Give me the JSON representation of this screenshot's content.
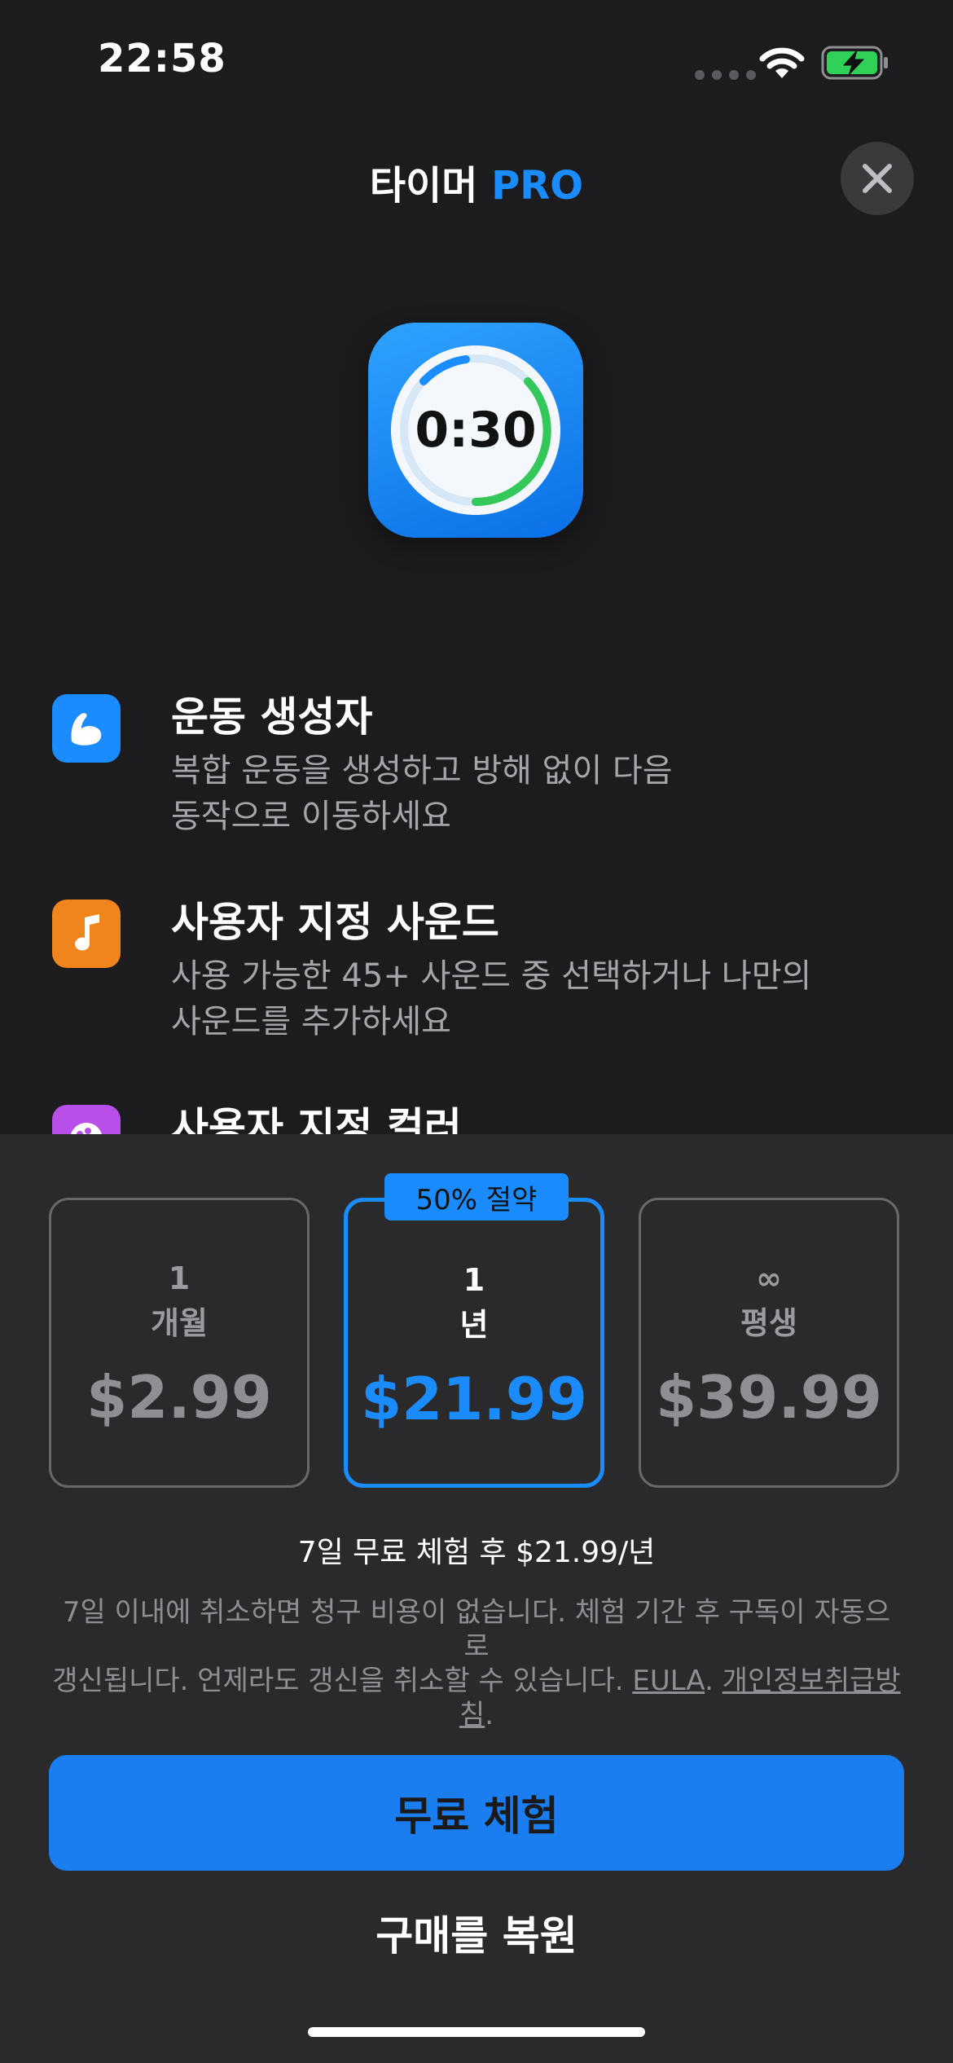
{
  "status_bar": {
    "time": "22:58"
  },
  "header": {
    "title_main": "타이머",
    "title_accent": "PRO"
  },
  "app_icon": {
    "display_time": "0:30"
  },
  "features": [
    {
      "title": "운동 생성자",
      "desc_line1": "복합 운동을 생성하고 방해 없이 다음",
      "desc_line2": "동작으로 이동하세요",
      "icon": "flexed-arm-icon",
      "color": "#1a8cff"
    },
    {
      "title": "사용자 지정 사운드",
      "desc_line1": "사용 가능한 45+ 사운드 중 선택하거나 나만의",
      "desc_line2": "사운드를 추가하세요",
      "icon": "music-note-icon",
      "color": "#f0851e"
    },
    {
      "title": "사용자 지정 컬러",
      "icon": "palette-icon",
      "color": "#b84fe8"
    }
  ],
  "plans": [
    {
      "count": "1",
      "unit": "개월",
      "price": "$2.99"
    },
    {
      "count": "1",
      "unit": "년",
      "price": "$21.99"
    },
    {
      "count": "∞",
      "unit": "평생",
      "price": "$39.99"
    }
  ],
  "badge": "50% 절약",
  "trial_summary": "7일 무료 체험 후 $21.99/년",
  "legal": {
    "line1": "7일 이내에 취소하면 청구 비용이 없습니다. 체험 기간 후 구독이 자동으로",
    "line2_text": "갱신됩니다. 언제라도 갱신을 취소할 수 있습니다. ",
    "eula": "EULA",
    "separator": ". ",
    "privacy_part1": "개인정보취급방",
    "privacy_part2": "침",
    "period": "."
  },
  "cta_label": "무료 체험",
  "restore_label": "구매를 복원",
  "colors": {
    "accent": "#1a8cff",
    "sheet": "#2a2a2c",
    "background": "#1c1c1e"
  }
}
